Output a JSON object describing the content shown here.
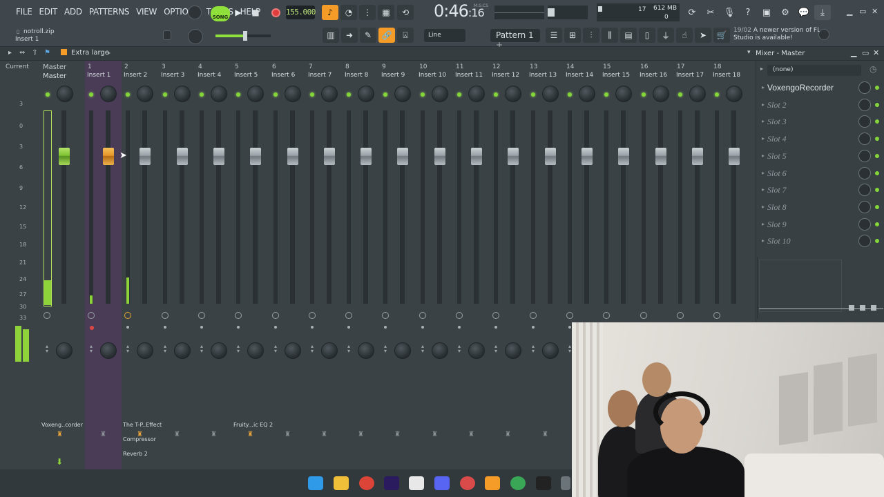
{
  "menu": [
    "FILE",
    "EDIT",
    "ADD",
    "PATTERNS",
    "VIEW",
    "OPTIONS",
    "TOOLS",
    "HELP"
  ],
  "transport": {
    "song_label": "SONG",
    "tempo": "155.000",
    "time": "0:46",
    "time_small": ":16",
    "time_unit": "M:S:CS",
    "pattern": "Pattern 1",
    "snap": "Line"
  },
  "status": {
    "poly": "17",
    "memory": "612 MB",
    "zero": "0"
  },
  "hint": {
    "date": "19/02",
    "text": "A newer version of FL Studio is available!"
  },
  "file": {
    "name": "notroll.zip",
    "selected_insert": "Insert 1"
  },
  "mixer": {
    "view_size": "Extra large",
    "window_title": "Mixer - Master",
    "current_label": "Current",
    "master_label": "Master",
    "master_name": "Master",
    "db_scale": [
      "3",
      "0",
      "3",
      "6",
      "9",
      "12",
      "15",
      "18",
      "21",
      "24",
      "27",
      "30",
      "33"
    ],
    "inserts": [
      {
        "num": "1",
        "name": "Insert 1"
      },
      {
        "num": "2",
        "name": "Insert 2"
      },
      {
        "num": "3",
        "name": "Insert 3"
      },
      {
        "num": "4",
        "name": "Insert 4"
      },
      {
        "num": "5",
        "name": "Insert 5"
      },
      {
        "num": "6",
        "name": "Insert 6"
      },
      {
        "num": "7",
        "name": "Insert 7"
      },
      {
        "num": "8",
        "name": "Insert 8"
      },
      {
        "num": "9",
        "name": "Insert 9"
      },
      {
        "num": "10",
        "name": "Insert 10"
      },
      {
        "num": "11",
        "name": "Insert 11"
      },
      {
        "num": "12",
        "name": "Insert 12"
      },
      {
        "num": "13",
        "name": "Insert 13"
      },
      {
        "num": "14",
        "name": "Insert 14"
      },
      {
        "num": "15",
        "name": "Insert 15"
      },
      {
        "num": "16",
        "name": "Insert 16"
      },
      {
        "num": "17",
        "name": "Insert 17"
      },
      {
        "num": "18",
        "name": "Insert 18"
      }
    ],
    "fx_labels": {
      "master": "Voxeng..corder",
      "insert2_a": "The T-P..Effect",
      "insert2_b": "Compressor",
      "insert2_c": "Reverb 2",
      "insert5": "Fruity...ic EQ 2"
    }
  },
  "fx_panel": {
    "preset": "(none)",
    "slots": [
      "VoxengoRecorder",
      "Slot 2",
      "Slot 3",
      "Slot 4",
      "Slot 5",
      "Slot 6",
      "Slot 7",
      "Slot 8",
      "Slot 9",
      "Slot 10"
    ]
  },
  "colors": {
    "accent_green": "#8fd33a",
    "accent_orange": "#f49b28",
    "selected_strip": "#4a3c57"
  }
}
